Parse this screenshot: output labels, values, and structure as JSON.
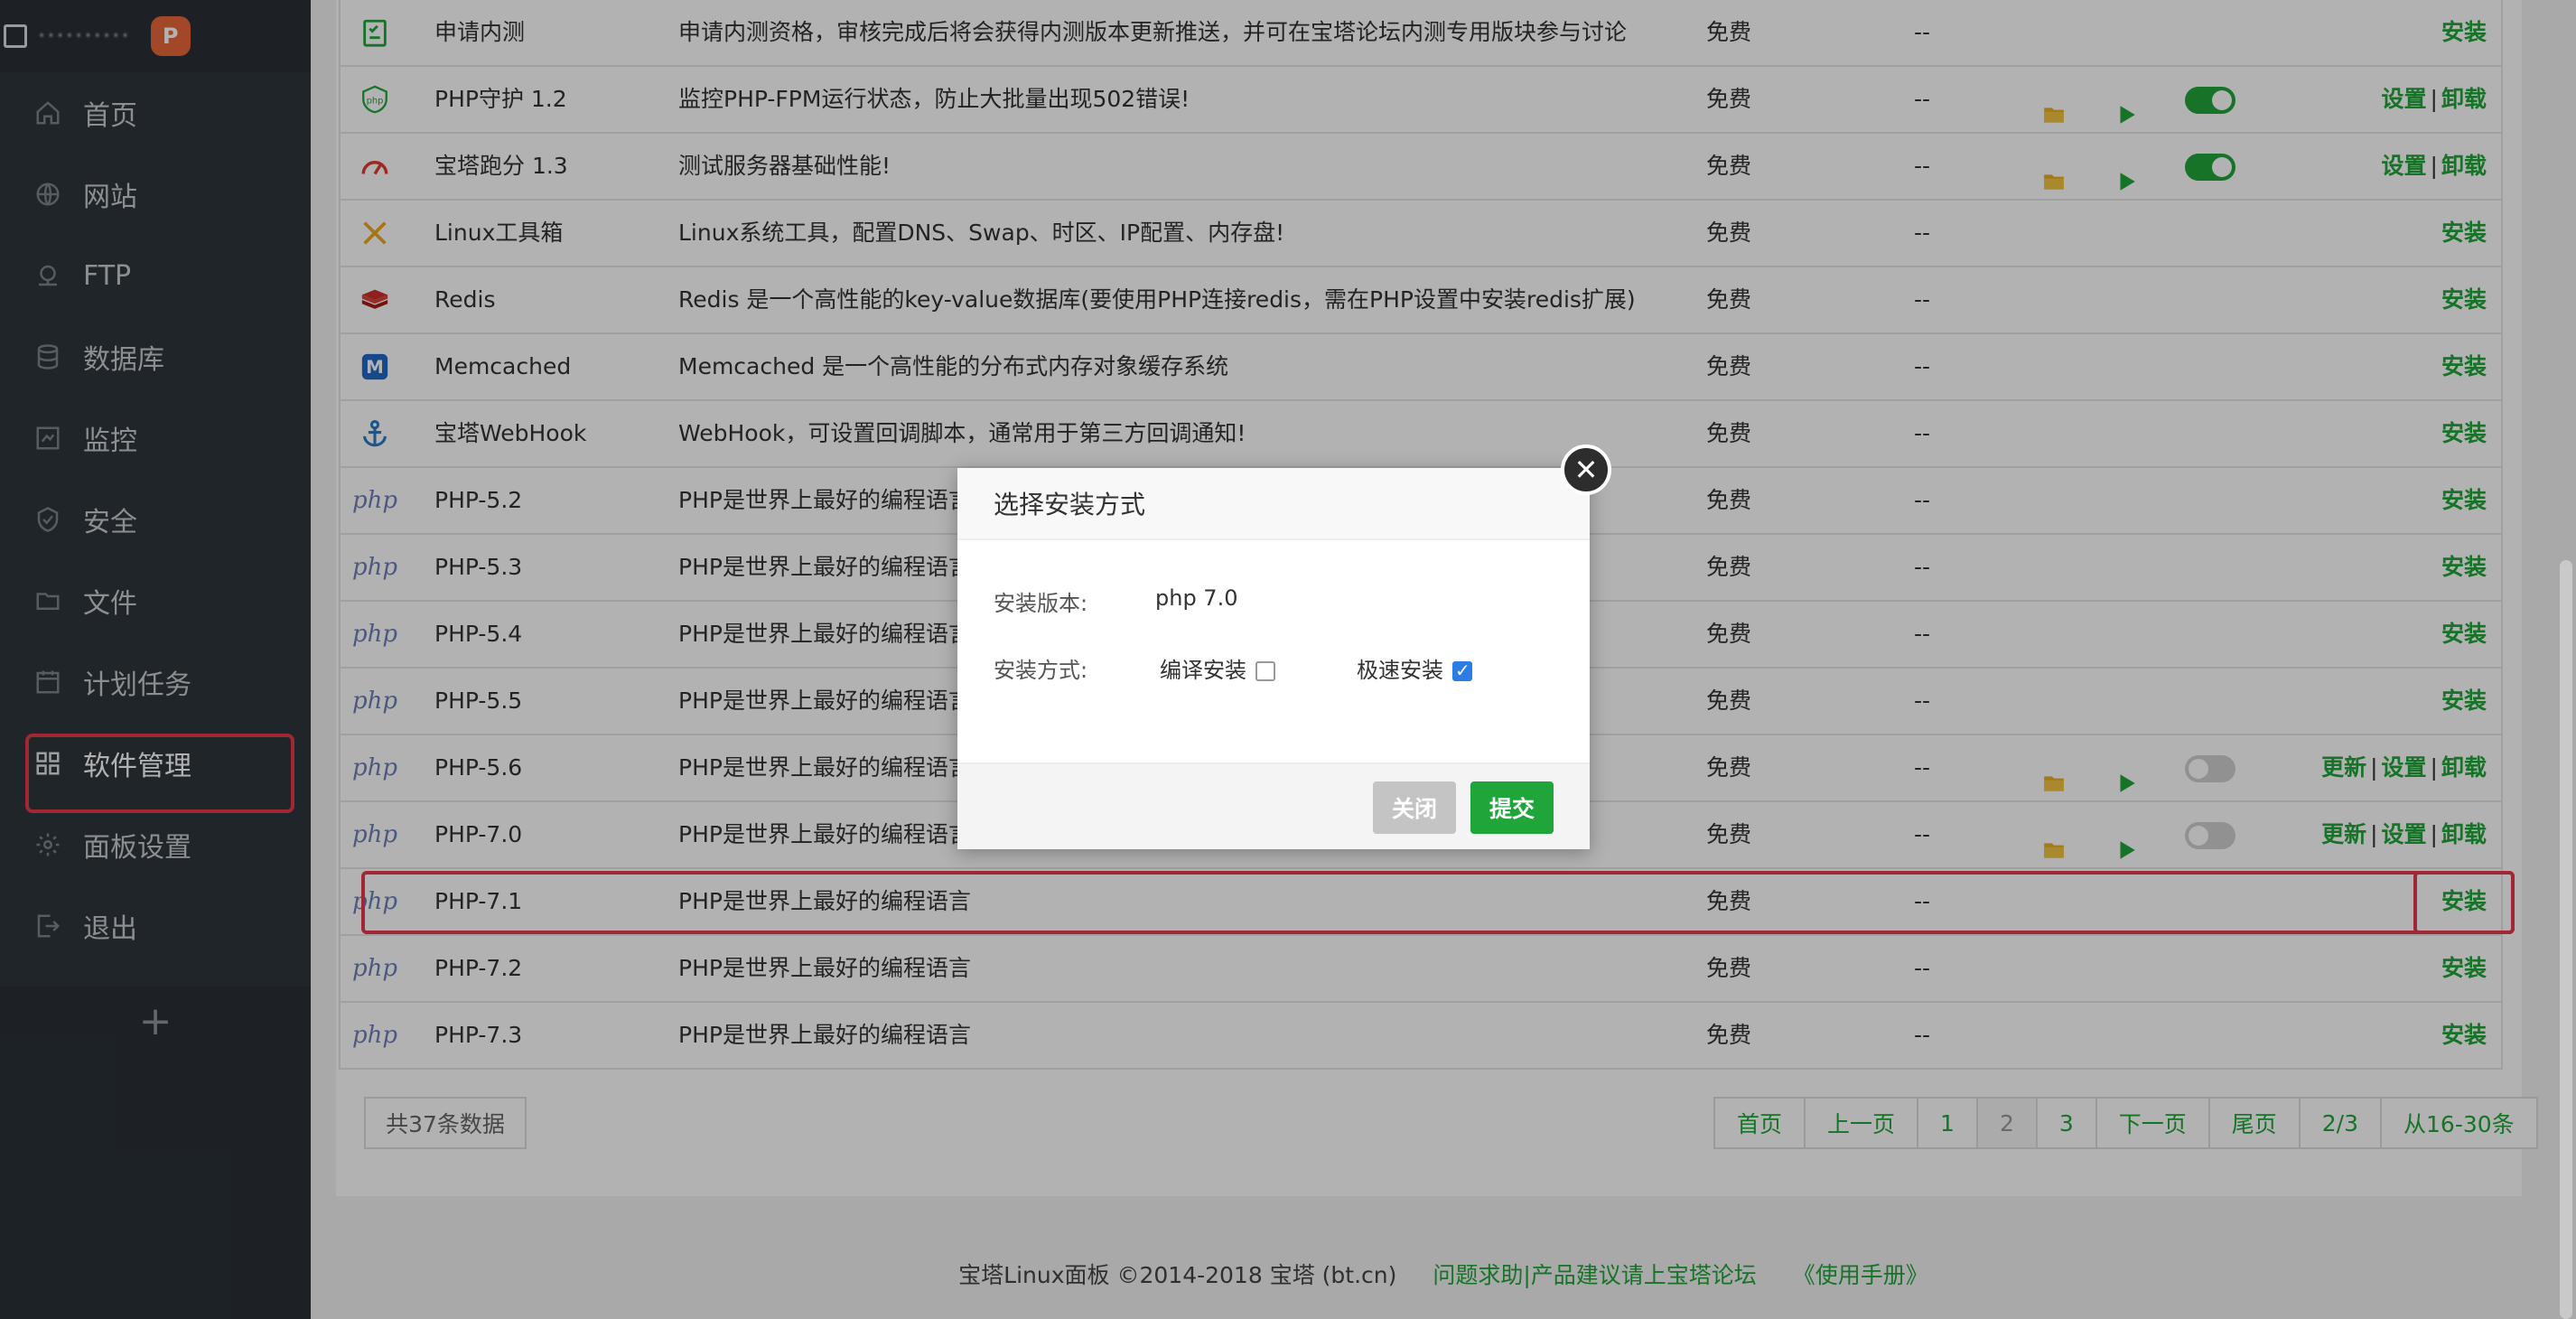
{
  "sidebar": {
    "brand": "··········",
    "items": [
      {
        "label": "首页",
        "icon": "home-icon"
      },
      {
        "label": "网站",
        "icon": "globe-icon"
      },
      {
        "label": "FTP",
        "icon": "ftp-icon"
      },
      {
        "label": "数据库",
        "icon": "database-icon"
      },
      {
        "label": "监控",
        "icon": "monitor-icon"
      },
      {
        "label": "安全",
        "icon": "shield-icon"
      },
      {
        "label": "文件",
        "icon": "folder-icon"
      },
      {
        "label": "计划任务",
        "icon": "calendar-icon"
      },
      {
        "label": "软件管理",
        "icon": "grid-icon"
      },
      {
        "label": "面板设置",
        "icon": "gear-icon"
      },
      {
        "label": "退出",
        "icon": "logout-icon"
      }
    ],
    "add": "+"
  },
  "table": {
    "rows": [
      {
        "name": "申请内测",
        "desc": "申请内测资格，审核完成后将会获得内测版本更新推送，并可在宝塔论坛内测专用版块参与讨论",
        "price": "免费",
        "expire": "--",
        "icon": "checklist-icon",
        "ops": [
          "安装"
        ]
      },
      {
        "name": "PHP守护 1.2",
        "desc": "监控PHP-FPM运行状态，防止大批量出现502错误!",
        "price": "免费",
        "expire": "--",
        "icon": "php-shield-icon",
        "folder": true,
        "play": true,
        "toggle": "on",
        "ops": [
          "设置",
          "卸载"
        ]
      },
      {
        "name": "宝塔跑分 1.3",
        "desc": "测试服务器基础性能!",
        "price": "免费",
        "expire": "--",
        "icon": "speedometer-icon",
        "folder": true,
        "play": true,
        "toggle": "on",
        "ops": [
          "设置",
          "卸载"
        ]
      },
      {
        "name": "Linux工具箱",
        "desc": "Linux系统工具，配置DNS、Swap、时区、IP配置、内存盘!",
        "price": "免费",
        "expire": "--",
        "icon": "tools-icon",
        "ops": [
          "安装"
        ]
      },
      {
        "name": "Redis",
        "desc": "Redis 是一个高性能的key-value数据库(要使用PHP连接redis，需在PHP设置中安装redis扩展)",
        "price": "免费",
        "expire": "--",
        "icon": "redis-icon",
        "ops": [
          "安装"
        ]
      },
      {
        "name": "Memcached",
        "desc": "Memcached 是一个高性能的分布式内存对象缓存系统",
        "price": "免费",
        "expire": "--",
        "icon": "memcached-icon",
        "ops": [
          "安装"
        ]
      },
      {
        "name": "宝塔WebHook",
        "desc": "WebHook，可设置回调脚本，通常用于第三方回调通知!",
        "price": "免费",
        "expire": "--",
        "icon": "anchor-icon",
        "ops": [
          "安装"
        ]
      },
      {
        "name": "PHP-5.2",
        "desc": "PHP是世界上最好的编程语言",
        "price": "免费",
        "expire": "--",
        "icon": "php-icon",
        "ops": [
          "安装"
        ]
      },
      {
        "name": "PHP-5.3",
        "desc": "PHP是世界上最好的编程语言",
        "price": "免费",
        "expire": "--",
        "icon": "php-icon",
        "ops": [
          "安装"
        ]
      },
      {
        "name": "PHP-5.4",
        "desc": "PHP是世界上最好的编程语言",
        "price": "免费",
        "expire": "--",
        "icon": "php-icon",
        "ops": [
          "安装"
        ]
      },
      {
        "name": "PHP-5.5",
        "desc": "PHP是世界上最好的编程语言",
        "price": "免费",
        "expire": "--",
        "icon": "php-icon",
        "ops": [
          "安装"
        ]
      },
      {
        "name": "PHP-5.6",
        "desc": "PHP是世界上最好的编程语言",
        "price": "免费",
        "expire": "--",
        "icon": "php-icon",
        "folder": true,
        "play": true,
        "toggle": "off",
        "ops": [
          "更新",
          "设置",
          "卸载"
        ]
      },
      {
        "name": "PHP-7.0",
        "desc": "PHP是世界上最好的编程语言",
        "price": "免费",
        "expire": "--",
        "icon": "php-icon",
        "folder": true,
        "play": true,
        "toggle": "off",
        "ops": [
          "更新",
          "设置",
          "卸载"
        ]
      },
      {
        "name": "PHP-7.1",
        "desc": "PHP是世界上最好的编程语言",
        "price": "免费",
        "expire": "--",
        "icon": "php-icon",
        "ops": [
          "安装"
        ]
      },
      {
        "name": "PHP-7.2",
        "desc": "PHP是世界上最好的编程语言",
        "price": "免费",
        "expire": "--",
        "icon": "php-icon",
        "ops": [
          "安装"
        ]
      },
      {
        "name": "PHP-7.3",
        "desc": "PHP是世界上最好的编程语言",
        "price": "免费",
        "expire": "--",
        "icon": "php-icon",
        "ops": [
          "安装"
        ]
      }
    ],
    "php_icon_text": "php",
    "total": "共37条数据",
    "pager": [
      "首页",
      "上一页",
      "1",
      "2",
      "3",
      "下一页",
      "尾页",
      "2/3",
      "从16-30条"
    ],
    "current_page": "2"
  },
  "footer": {
    "copyright": "宝塔Linux面板 ©2014-2018 宝塔 (bt.cn)",
    "help": "问题求助|产品建议请上宝塔论坛",
    "manual": "《使用手册》"
  },
  "dialog": {
    "title": "选择安装方式",
    "version_label": "安装版本:",
    "version_value": "php 7.0",
    "method_label": "安装方式:",
    "compile_label": "编译安装",
    "compile_checked": false,
    "fast_label": "极速安装",
    "fast_checked": true,
    "close_label": "关闭",
    "submit_label": "提交",
    "close_x": "✕"
  },
  "colors": {
    "accent": "#20a53a",
    "highlight": "#e8394d",
    "sidebar": "#2f353b"
  }
}
